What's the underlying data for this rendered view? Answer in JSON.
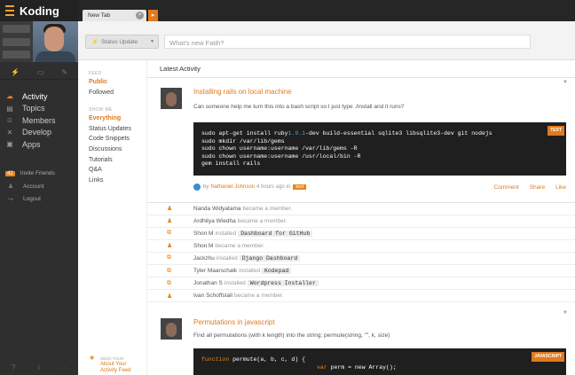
{
  "app": {
    "title": "Koding"
  },
  "tabs": [
    {
      "label": "New Tab"
    }
  ],
  "sidebar": {
    "nav": [
      {
        "label": "Activity",
        "icon": "activity-icon",
        "active": true
      },
      {
        "label": "Topics",
        "icon": "topics-icon"
      },
      {
        "label": "Members",
        "icon": "members-icon"
      },
      {
        "label": "Develop",
        "icon": "develop-icon"
      },
      {
        "label": "Apps",
        "icon": "apps-icon"
      }
    ],
    "secondary": [
      {
        "label": "Invite Friends",
        "badge": "42"
      },
      {
        "label": "Account"
      },
      {
        "label": "Logout"
      }
    ]
  },
  "status": {
    "button_label": "Status Update",
    "placeholder": "What's new Fatih?"
  },
  "filters": {
    "feed_header": "FEED",
    "feed": [
      "Public",
      "Followed"
    ],
    "show_header": "SHOW ME",
    "show": [
      "Everything",
      "Status Updates",
      "Code Snippets",
      "Discussions",
      "Tutorials",
      "Q&A",
      "Links"
    ],
    "promo_small": "NEED YOUR",
    "promo_line1": "About Your",
    "promo_line2": "Activity Feed"
  },
  "feed": {
    "header": "Latest Activity",
    "post1": {
      "title": "Installing rails on local machine",
      "body": "Can someone help me turn this into a bash script so I just type ./install and it runs?",
      "code_tag": "TEXT",
      "code": [
        "sudo apt-get install ruby1.9.1-dev build-essential sqlite3 libsqlite3-dev git nodejs",
        "sudo mkdir /var/lib/gems",
        "sudo chown username:username /var/lib/gems -R",
        "sudo chown username:username /usr/local/bin -R",
        "gem install rails"
      ],
      "by_prefix": "by",
      "author": "Nathaniel Johnson",
      "time": "4 hours ago",
      "in_word": "in",
      "tag": "text",
      "actions": [
        "Comment",
        "Share",
        "Like"
      ]
    },
    "activities": [
      {
        "name": "Nanda Widyatama",
        "verb": "became a member.",
        "app": ""
      },
      {
        "name": "Ardhitya Wiedha",
        "verb": "became a member.",
        "app": ""
      },
      {
        "name": "Shon M",
        "verb": "installed",
        "app": "Dashboard for GitHub"
      },
      {
        "name": "Shon M",
        "verb": "became a member.",
        "app": ""
      },
      {
        "name": "Jackzhu",
        "verb": "installed",
        "app": "Django Dashboard"
      },
      {
        "name": "Tyler Maarschalk",
        "verb": "installed",
        "app": "Kodepad"
      },
      {
        "name": "Jonathan S",
        "verb": "installed",
        "app": "Wordpress Installer"
      },
      {
        "name": "Ivan Schoffstall",
        "verb": "became a member.",
        "app": ""
      }
    ],
    "post2": {
      "title": "Permutations in javascript",
      "body": "Find all permutations (with k length) into the string: permute(string, \"\", k, size)",
      "code_tag": "JAVASCRIPT",
      "code_fn": "function",
      "code_sig": " permute(a, b, c, d) {",
      "code_line2_var": "var",
      "code_line2_rest": " perm = new Array();"
    }
  },
  "colors": {
    "accent": "#e07a1c",
    "sidebar": "#2f2f2f",
    "topbar": "#262626"
  }
}
